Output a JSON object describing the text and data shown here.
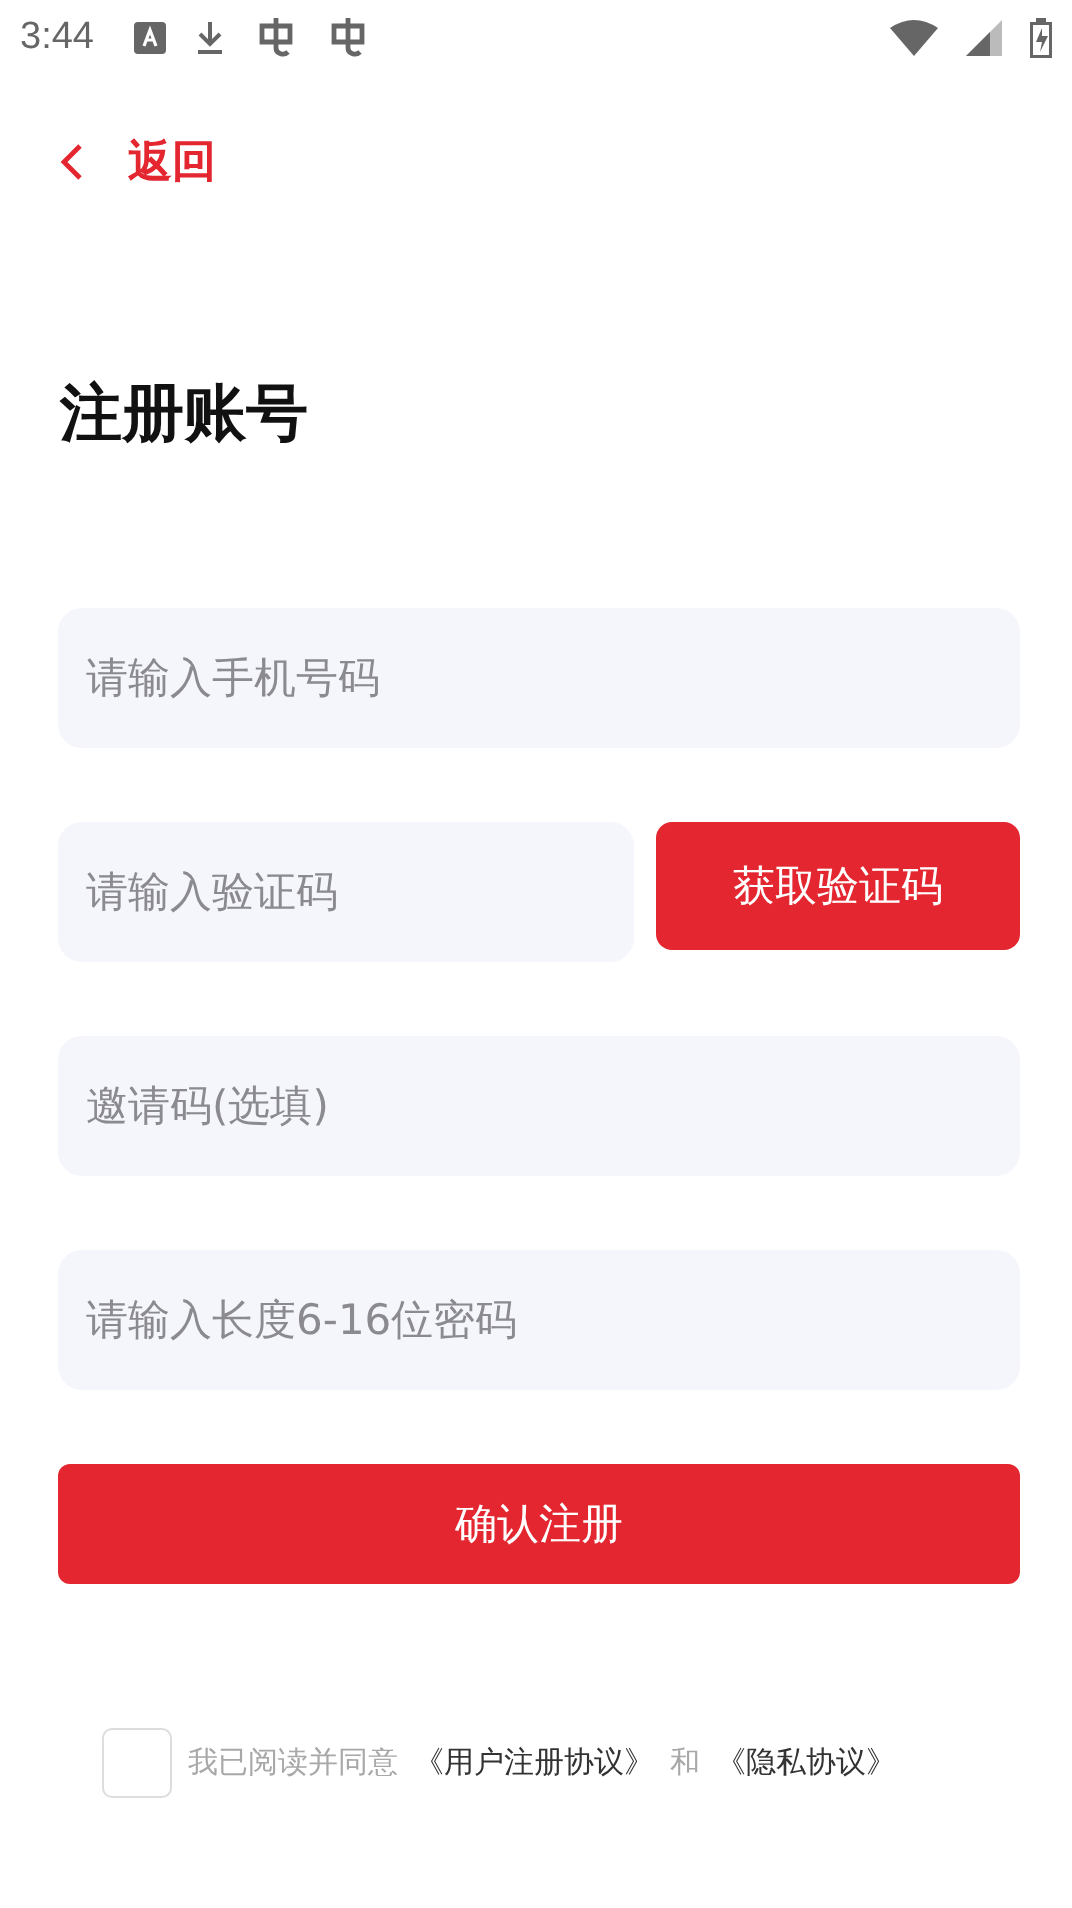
{
  "status_bar": {
    "time": "3:44"
  },
  "back": {
    "label": "返回"
  },
  "title": "注册账号",
  "form": {
    "phone": {
      "placeholder": "请输入手机号码"
    },
    "code": {
      "placeholder": "请输入验证码"
    },
    "get_code_button": "获取验证码",
    "invite": {
      "placeholder": "邀请码(选填)"
    },
    "password": {
      "placeholder": "请输入长度6-16位密码"
    },
    "submit_button": "确认注册"
  },
  "agreement": {
    "checked": false,
    "text": "我已阅读并同意",
    "user_agreement": "《用户注册协议》",
    "joiner": "和",
    "privacy": "《隐私协议》"
  }
}
